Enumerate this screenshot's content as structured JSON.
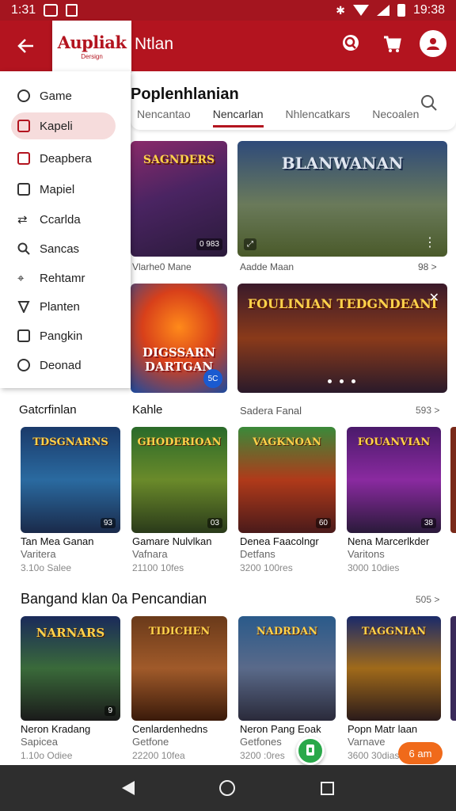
{
  "status_bar": {
    "time_left": "1:31",
    "time_right": "19:38"
  },
  "app_bar": {
    "logo_text": "Aupliak",
    "logo_sub": "Dersign",
    "title": "Ntlan"
  },
  "drawer": {
    "items": [
      {
        "label": "Game",
        "icon": "headset-icon",
        "active": false
      },
      {
        "label": "Kapeli",
        "icon": "edit-box-icon",
        "active": true
      },
      {
        "label": "Deapbera",
        "icon": "card-icon",
        "active": false
      },
      {
        "label": "Mapiel",
        "icon": "clipboard-icon",
        "active": false
      },
      {
        "label": "Ccarlda",
        "icon": "swap-icon",
        "active": false
      },
      {
        "label": "Sancas",
        "icon": "search-icon",
        "active": false
      },
      {
        "label": "Rehtamr",
        "icon": "pin-icon",
        "active": false
      },
      {
        "label": "Planten",
        "icon": "shield-icon",
        "active": false
      },
      {
        "label": "Pangkin",
        "icon": "list-box-icon",
        "active": false
      },
      {
        "label": "Deonad",
        "icon": "circle-icon",
        "active": false
      }
    ]
  },
  "header": {
    "section_title": "Poplenhlanian",
    "tabs": [
      "Nencantao",
      "Nencarlan",
      "Nhlencatkars",
      "Necoalen"
    ]
  },
  "featured": [
    {
      "art_text": "SAGNDERS",
      "badge": "0 983",
      "caption": "Vlarhe0 Mane"
    },
    {
      "art_text": "BLANWANAN",
      "caption": "Aadde Maan",
      "badge": "⤢",
      "meta": "98 >"
    },
    {
      "art_text": "DIGSSARN DARTGAN",
      "badge": "5C"
    },
    {
      "art_text": "FOULINIAN TEDGNDEANI"
    }
  ],
  "row1": {
    "left_label": "Gatcrfinlan",
    "mid_label": "Kahle",
    "right_label": "Sadera Fanal",
    "see_all": "593 >",
    "cards": [
      {
        "art": "TDSGNARNS",
        "title": "Tan Mea Ganan",
        "sub": "Varitera",
        "meta": "3.10o Salee",
        "badge": "93"
      },
      {
        "art": "GHODERIOAN",
        "title": "Gamare Nulvlkan",
        "sub": "Vafnara",
        "meta": "21100 10fes",
        "badge": "03"
      },
      {
        "art": "VAGKNOAN",
        "title": "Denea Faacolngr",
        "sub": "Detfans",
        "meta": "3200 100res",
        "badge": "60"
      },
      {
        "art": "FOUANVIAN",
        "title": "Nena Marcerlkder",
        "sub": "Varitons",
        "meta": "3000 10dies",
        "badge": "38"
      }
    ]
  },
  "row2": {
    "title": "Bangand klan 0a Pencandian",
    "see_all": "505 >",
    "cards": [
      {
        "art": "NARNARS",
        "title": "Neron Kradang",
        "sub": "Sapicea",
        "meta": "1.10o Odiee",
        "badge": "9"
      },
      {
        "art": "TIDICHEN",
        "title": "Cenlardenhedns",
        "sub": "Getfone",
        "meta": "22200 10fea",
        "badge": ""
      },
      {
        "art": "NADRDAN",
        "title": "Neron Pang Eoak",
        "sub": "Getfones",
        "meta": "3200 :0res",
        "badge": ""
      },
      {
        "art": "TAGGNIAN",
        "title": "Popn Matr laan",
        "sub": "Varnave",
        "meta": "3600 30dias",
        "badge": ""
      }
    ],
    "pill_label": "6 am"
  }
}
